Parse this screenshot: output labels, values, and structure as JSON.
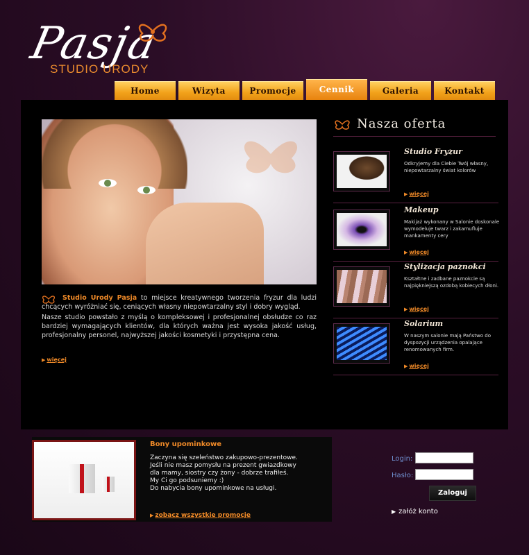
{
  "header": {
    "logo_script": "Pasja",
    "logo_sub": "STUDIO URODY"
  },
  "nav": [
    "Home",
    "Wizyta",
    "Promocje",
    "Cennik",
    "Galeria",
    "Kontakt"
  ],
  "nav_active_index": 3,
  "intro": {
    "brand": "Studio Urody Pasja",
    "p1_rest": " to miejsce kreatywnego tworzenia fryzur dla ludzi chcących wyróżniać się, ceniących własny niepowtarzalny styl i dobry wygląd.",
    "p2": "Nasze studio powstało z myślą o kompleksowej i profesjonalnej obsłudze co raz bardziej wymagających klientów, dla których ważna jest wysoka jakość usług, profesjonalny personel, najwyższej jakości kosmetyki i przystępna cena.",
    "more": "więcej"
  },
  "offer": {
    "title": "Nasza oferta",
    "items": [
      {
        "title": "Studio Fryzur",
        "desc": "Odkryjemy dla Ciebie Twój własny, niepowtarzalny świat kolorów",
        "more": "więcej"
      },
      {
        "title": "Makeup",
        "desc": "Makijaż wykonany w Salonie doskonale wymodeluje twarz i zakamufluje mankamenty cery",
        "more": "więcej"
      },
      {
        "title": "Stylizacja paznokci",
        "desc": "Kształtne i zadbane paznokcie są najpiękniejszą ozdobą kobiecych dłoni.",
        "more": "więcej"
      },
      {
        "title": "Solarium",
        "desc": "W naszym salonie mają Państwo do dyspozycji urządzenia opalające renomowanych firm.",
        "more": "więcej"
      }
    ]
  },
  "promo": {
    "title": "Bony upominkowe",
    "lines": [
      "Zaczyna się szeleństwo zakupowo-prezentowe.",
      "Jeśli nie masz pomysłu na prezent gwiazdkowy",
      "dla mamy, siostry czy żony - dobrze trafiłeś.",
      "My Ci go podsuniemy :)",
      "Do nabycia bony upominkowe na usługi."
    ],
    "link": "zobacz wszystkie promocje"
  },
  "login": {
    "login_label": "Login:",
    "password_label": "Hasło:",
    "login_value": "",
    "password_value": "",
    "submit": "Zaloguj",
    "register": "załóż konto"
  },
  "colors": {
    "accent": "#f08a28",
    "nav": "#f2a21a",
    "bg": "#2b0d26"
  }
}
